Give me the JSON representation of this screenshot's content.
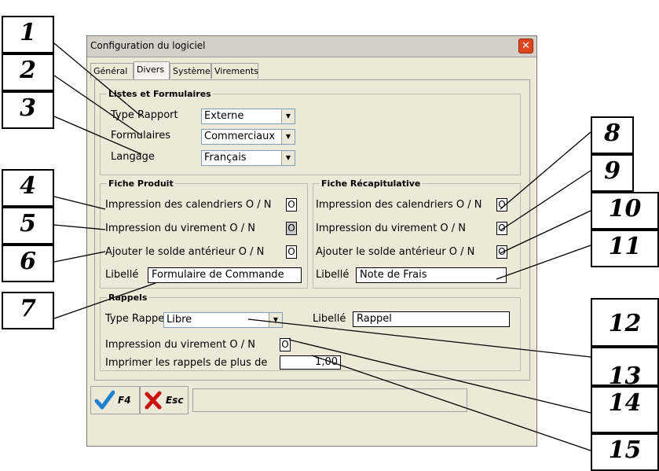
{
  "window": {
    "title": "Configuration du logiciel",
    "close_glyph": "✕"
  },
  "tabs": [
    {
      "label": "Général",
      "active": false
    },
    {
      "label": "Divers",
      "active": true
    },
    {
      "label": "Système",
      "active": false
    },
    {
      "label": "Virements",
      "active": false
    }
  ],
  "listes": {
    "legend": "Listes et Formulaires",
    "type_rapport": {
      "label": "Type Rapport",
      "value": "Externe"
    },
    "formulaires": {
      "label": "Formulaires",
      "value": "Commerciaux"
    },
    "langage": {
      "label": "Langage",
      "value": "Français"
    }
  },
  "fiche_produit": {
    "legend": "Fiche Produit",
    "impression_calendriers": {
      "label": "Impression des calendriers O / N",
      "value": "O"
    },
    "impression_virement": {
      "label": "Impression du virement O / N",
      "value": "O"
    },
    "ajouter_solde": {
      "label": "Ajouter le solde antérieur O / N",
      "value": "O"
    },
    "libelle": {
      "label": "Libellé",
      "value": "Formulaire de Commande"
    }
  },
  "fiche_recap": {
    "legend": "Fiche Récapitulative",
    "impression_calendriers": {
      "label": "Impression des calendriers O / N",
      "value": "O"
    },
    "impression_virement": {
      "label": "Impression du virement O / N",
      "value": "O"
    },
    "ajouter_solde": {
      "label": "Ajouter le solde antérieur O / N",
      "value": "O"
    },
    "libelle": {
      "label": "Libellé",
      "value": "Note de Frais"
    }
  },
  "rappels": {
    "legend": "Rappels",
    "type_rappel": {
      "label": "Type Rappel",
      "value": "Libre"
    },
    "libelle": {
      "label": "Libellé",
      "value": "Rappel"
    },
    "impression_virement": {
      "label": "Impression du virement O / N",
      "value": "O"
    },
    "imprimer_plus_de": {
      "label": "Imprimer les rappels de plus de",
      "value": "1,00"
    }
  },
  "toolbar": {
    "ok_label": "F4",
    "cancel_label": "Esc"
  },
  "callouts": [
    "1",
    "2",
    "3",
    "4",
    "5",
    "6",
    "7",
    "8",
    "9",
    "10",
    "11",
    "12",
    "13",
    "14",
    "15"
  ],
  "colors": {
    "ok_check": "#1f7fd0",
    "cancel_x": "#cc1111",
    "close_button": "#e0451f"
  }
}
